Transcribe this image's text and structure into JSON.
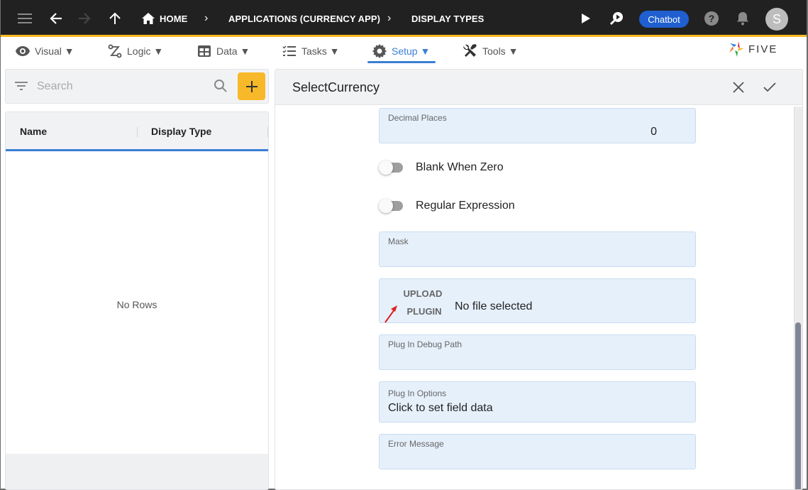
{
  "topbar": {
    "breadcrumbs": [
      "HOME",
      "APPLICATIONS (CURRENCY APP)",
      "DISPLAY TYPES"
    ],
    "chatbot_label": "Chatbot",
    "avatar_initial": "S"
  },
  "menu": {
    "items": [
      {
        "label": "Visual ▼",
        "icon": "eye-icon"
      },
      {
        "label": "Logic ▼",
        "icon": "logic-flow-icon"
      },
      {
        "label": "Data ▼",
        "icon": "table-icon"
      },
      {
        "label": "Tasks ▼",
        "icon": "checklist-icon"
      },
      {
        "label": "Setup ▼",
        "icon": "gear-icon",
        "active": true
      },
      {
        "label": "Tools ▼",
        "icon": "tools-icon"
      }
    ],
    "logo_text": "FIVE"
  },
  "left_panel": {
    "search_placeholder": "Search",
    "columns": [
      "Name",
      "Display Type"
    ],
    "empty_text": "No Rows"
  },
  "form": {
    "title": "SelectCurrency",
    "decimal_places": {
      "label": "Decimal Places",
      "value": "0"
    },
    "blank_when_zero": {
      "label": "Blank When Zero",
      "on": false
    },
    "regular_expression": {
      "label": "Regular Expression",
      "on": false
    },
    "mask": {
      "label": "Mask",
      "value": ""
    },
    "upload": {
      "button_line1": "UPLOAD",
      "button_line2": "PLUGIN",
      "status": "No file selected"
    },
    "plugin_debug_path": {
      "label": "Plug In Debug Path",
      "value": ""
    },
    "plugin_options": {
      "label": "Plug In Options",
      "value": "Click to set field data"
    },
    "error_message": {
      "label": "Error Message",
      "value": ""
    }
  },
  "colors": {
    "topbar_bg": "#212121",
    "accent_yellow": "#f9b826",
    "accent_blue": "#3a7fd5",
    "chatbot_blue": "#1f5fd0",
    "field_bg": "#e6f0fb",
    "annotation_arrow": "#e02020"
  }
}
